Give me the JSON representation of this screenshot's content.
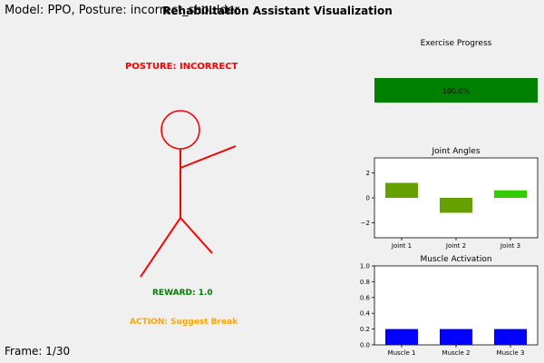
{
  "header": {
    "model_info": "Model: PPO, Posture: incorrect_shoulder",
    "title": "Rehabilitation Assistant Visualization"
  },
  "left_panel": {
    "posture_status": "POSTURE: INCORRECT",
    "reward": "REWARD: 1.0",
    "action": "ACTION: Suggest Break",
    "frame": "Frame: 1/30"
  },
  "colors": {
    "figure": "#ff0000",
    "posture_status": "#ff0000",
    "reward": "#008000",
    "action": "#ffa500",
    "progress_fill": "#008000",
    "muscle_bars": "#0000ff",
    "joint_bars": [
      "#66a000",
      "#66a000",
      "#33cc00"
    ]
  },
  "chart_data": [
    {
      "id": "exercise_progress",
      "type": "bar",
      "title": "Exercise Progress",
      "values": [
        100.0
      ],
      "value_label": "100.0%",
      "xlim": [
        0,
        100
      ]
    },
    {
      "id": "joint_angles",
      "type": "bar",
      "title": "Joint Angles",
      "categories": [
        "Joint 1",
        "Joint 2",
        "Joint 3"
      ],
      "values": [
        1.2,
        -1.2,
        0.6
      ],
      "ylim": [
        -3.2,
        3.2
      ],
      "yticks": [
        -2,
        0,
        2
      ],
      "ytick_labels": [
        "−2",
        "0",
        "2"
      ]
    },
    {
      "id": "muscle_activation",
      "type": "bar",
      "title": "Muscle Activation",
      "categories": [
        "Muscle 1",
        "Muscle 2",
        "Muscle 3"
      ],
      "values": [
        0.2,
        0.2,
        0.2
      ],
      "ylim": [
        0,
        1.0
      ],
      "yticks": [
        0.0,
        0.2,
        0.4,
        0.6,
        0.8,
        1.0
      ],
      "ytick_labels": [
        "0.0",
        "0.2",
        "0.4",
        "0.6",
        "0.8",
        "1.0"
      ]
    }
  ]
}
